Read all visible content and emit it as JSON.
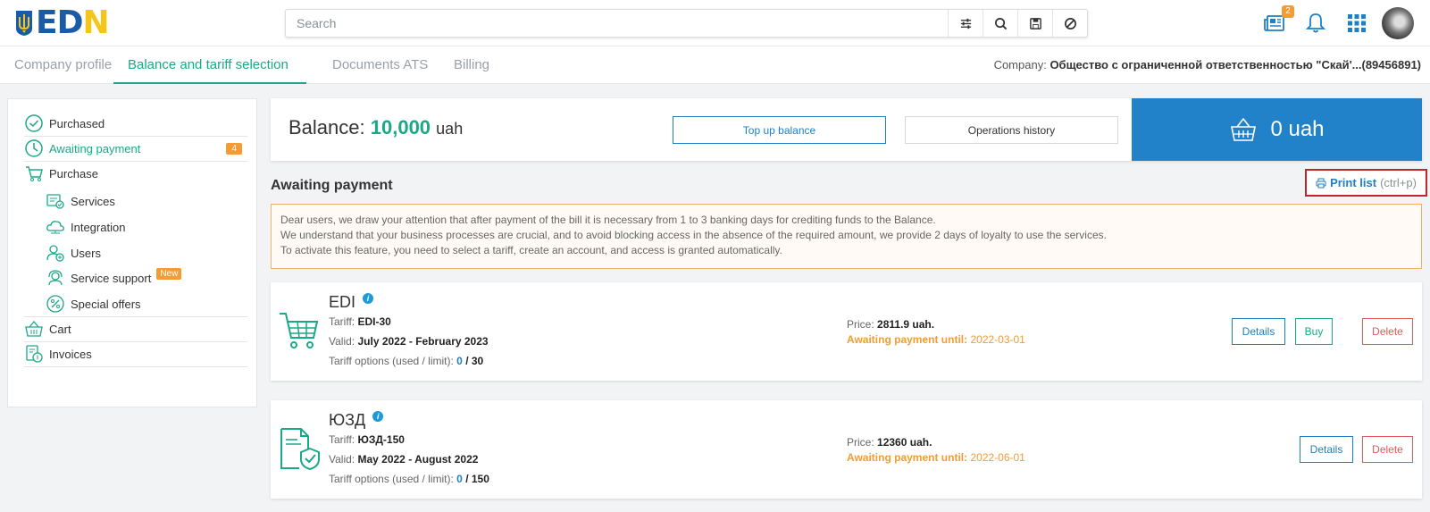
{
  "header": {
    "logo_text": "EDIN",
    "search_placeholder": "Search",
    "news_badge": "2"
  },
  "tabs": [
    {
      "label": "Company profile",
      "active": false
    },
    {
      "label": "Balance and tariff selection",
      "active": true
    },
    {
      "label": "Documents ATS",
      "active": false
    },
    {
      "label": "Billing",
      "active": false
    }
  ],
  "company": {
    "label": "Company:",
    "name": "Общество с ограниченной ответственностью \"Скай'...(89456891)"
  },
  "sidebar": {
    "items": [
      {
        "label": "Purchased"
      },
      {
        "label": "Awaiting payment",
        "count": "4",
        "active": true
      },
      {
        "label": "Purchase"
      },
      {
        "label": "Services"
      },
      {
        "label": "Integration"
      },
      {
        "label": "Users"
      },
      {
        "label": "Service support",
        "badge": "New"
      },
      {
        "label": "Special offers"
      },
      {
        "label": "Cart"
      },
      {
        "label": "Invoices"
      }
    ]
  },
  "balance": {
    "label": "Balance:",
    "amount": "10,000",
    "unit": "uah",
    "top_up_label": "Top up balance",
    "history_label": "Operations history",
    "cart_total": "0 uah"
  },
  "section": {
    "title": "Awaiting payment",
    "print_label": "Print list",
    "print_shortcut": "(ctrl+p)"
  },
  "notice": {
    "lines": [
      "Dear users, we draw your attention that after payment of the bill it is necessary from 1 to 3 banking days for crediting funds to the Balance.",
      "We understand that your business processes are crucial, and to avoid blocking access in the absence of the required amount, we provide 2 days of loyalty to use the services.",
      "To activate this feature, you need to select a tariff, create an account, and access is granted automatically."
    ]
  },
  "products": [
    {
      "name": "EDI",
      "tariff_label": "Tariff:",
      "tariff": "EDI-30",
      "valid_label": "Valid:",
      "valid": "July 2022 - February 2023",
      "options_label": "Tariff options (used / limit):",
      "used": "0",
      "limit": "/ 30",
      "price_label": "Price:",
      "price": "2811.9 uah.",
      "await_label": "Awaiting payment until:",
      "await_date": "2022-03-01",
      "details": "Details",
      "buy": "Buy",
      "delete": "Delete"
    },
    {
      "name": "ЮЗД",
      "tariff_label": "Tariff:",
      "tariff": "ЮЗД-150",
      "valid_label": "Valid:",
      "valid": "May 2022 - August 2022",
      "options_label": "Tariff options (used / limit):",
      "used": "0",
      "limit": "/ 150",
      "price_label": "Price:",
      "price": "12360 uah.",
      "await_label": "Awaiting payment until:",
      "await_date": "2022-06-01",
      "details": "Details",
      "delete": "Delete"
    }
  ],
  "colors": {
    "accent_green": "#1ba889",
    "accent_blue": "#2282c9",
    "warning_orange": "#f39c35",
    "danger_red": "#e05a5a"
  }
}
